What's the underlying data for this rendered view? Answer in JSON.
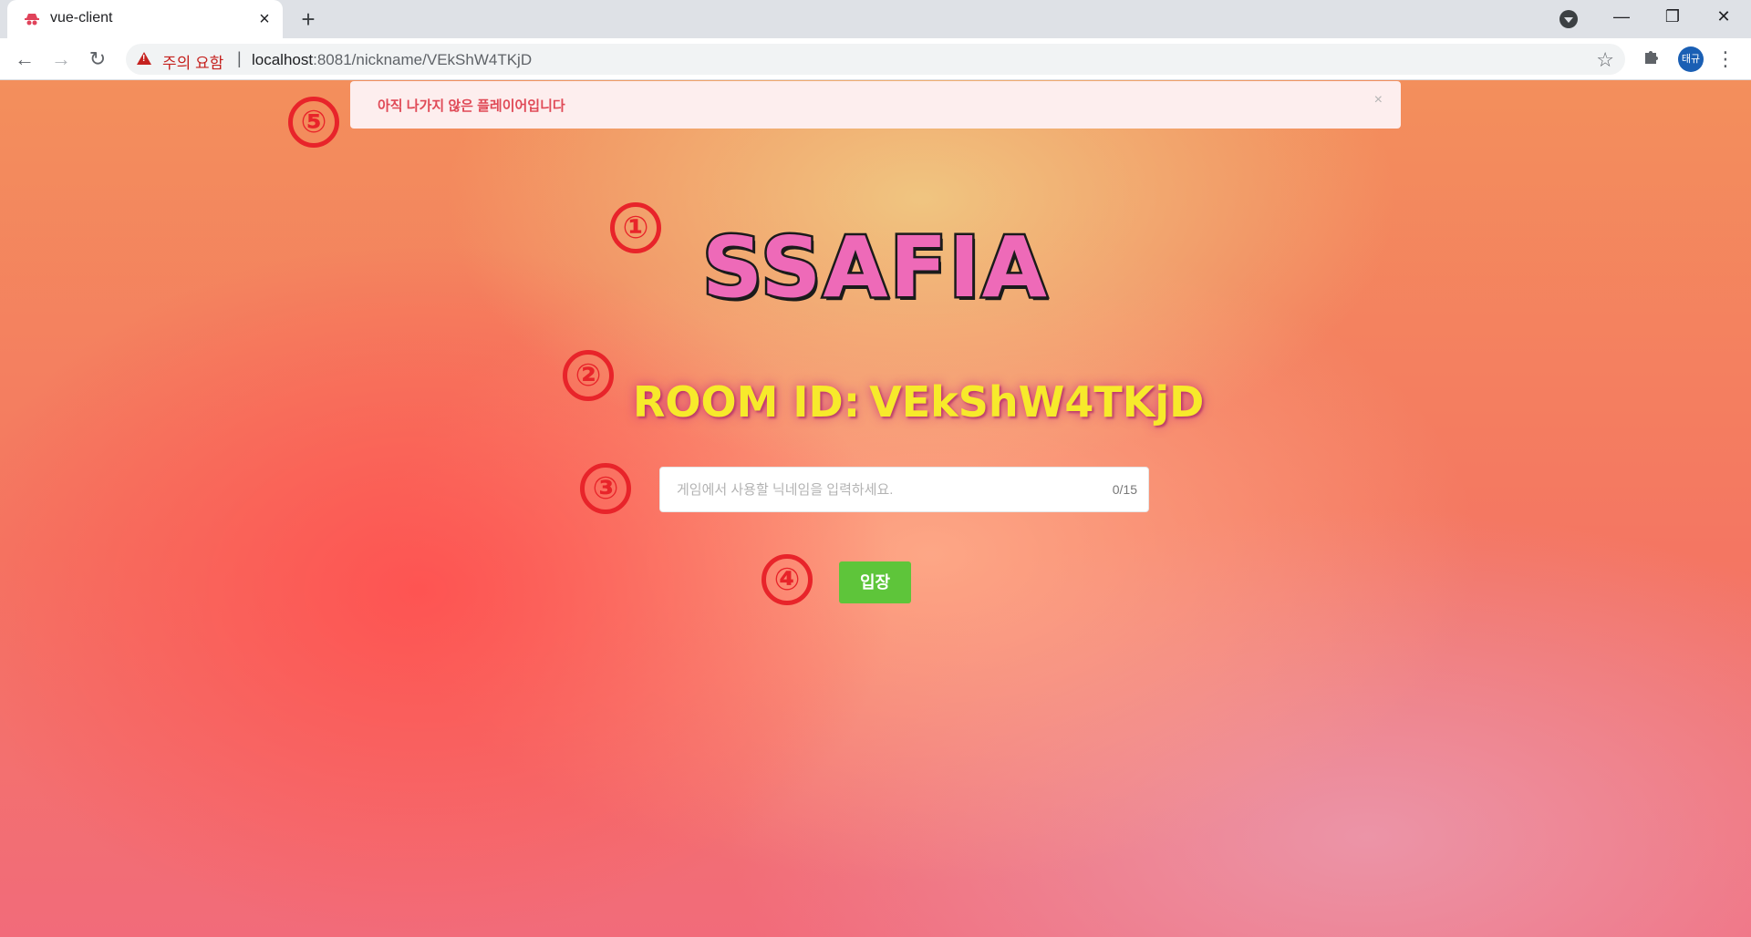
{
  "browser": {
    "tab_title": "vue-client",
    "tab_close": "×",
    "new_tab": "+",
    "security_warning": "주의 요함",
    "url_separator": "|",
    "url_host": "localhost",
    "url_rest": ":8081/nickname/VEkShW4TKjD",
    "profile_label": "태규",
    "window_buttons": [
      "—",
      "❐",
      "✕"
    ]
  },
  "alert": {
    "message": "아직 나가지 않은 플레이어입니다",
    "close": "×"
  },
  "markers": [
    "①",
    "②",
    "③",
    "④",
    "⑤"
  ],
  "logo": {
    "text": "SSAFIA"
  },
  "room": {
    "label": "ROOM ID:",
    "value": "VEkShW4TKjD"
  },
  "nickname": {
    "placeholder": "게임에서 사용할 닉네임을 입력하세요.",
    "value": "",
    "counter": "0/15"
  },
  "enter_button": {
    "label": "입장"
  },
  "colors": {
    "alert_text": "#e04a57",
    "alert_bg": "#fdeeee",
    "marker": "#e8242a",
    "logo_fill": "#ee6ab8",
    "room_id_text": "#f7ea2b",
    "enter_button": "#5ec53a"
  }
}
